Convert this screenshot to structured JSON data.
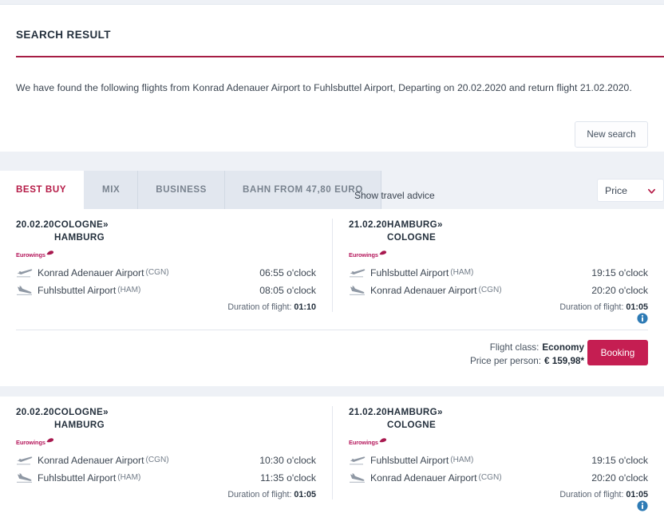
{
  "header": {
    "title": "SEARCH RESULT",
    "intro": "We have found the following flights from Konrad Adenauer Airport to Fuhlsbuttel Airport, Departing on 20.02.2020 and return flight 21.02.2020.",
    "new_search_label": "New search"
  },
  "tabs": [
    {
      "label": "BEST BUY",
      "active": true
    },
    {
      "label": "MIX",
      "active": false
    },
    {
      "label": "BUSINESS",
      "active": false
    },
    {
      "label": "BAHN FROM 47,80 EURO",
      "active": false
    }
  ],
  "toolbar": {
    "travel_advice_label": "Show travel advice",
    "sort_value": "Price"
  },
  "labels": {
    "duration_label": "Duration of flight:",
    "flight_class_label": "Flight class:",
    "price_label": "Price per person:",
    "booking_label": "Booking",
    "clock_suffix": "o'clock",
    "route_arrow": "»",
    "airline_name": "Eurowings"
  },
  "colors": {
    "accent": "#a61d44",
    "brand": "#c51e52",
    "airline": "#b5185c",
    "info": "#2e7bb5",
    "page_bg": "#eef1f6",
    "tab_inactive_bg": "#e2e7ef"
  },
  "results": [
    {
      "outbound": {
        "date": "20.02.20",
        "from_city": "COLOGNE",
        "to_city": "HAMBURG",
        "airline": "Eurowings",
        "depart_airport": "Konrad Adenauer Airport",
        "depart_code": "(CGN)",
        "depart_time": "06:55 o'clock",
        "arrive_airport": "Fuhlsbuttel Airport",
        "arrive_code": "(HAM)",
        "arrive_time": "08:05 o'clock",
        "duration": "01:10"
      },
      "inbound": {
        "date": "21.02.20",
        "from_city": "HAMBURG",
        "to_city": "COLOGNE",
        "airline": "Eurowings",
        "depart_airport": "Fuhlsbuttel Airport",
        "depart_code": "(HAM)",
        "depart_time": "19:15 o'clock",
        "arrive_airport": "Konrad Adenauer Airport",
        "arrive_code": "(CGN)",
        "arrive_time": "20:20 o'clock",
        "duration": "01:05"
      },
      "flight_class": "Economy",
      "price": "€ 159,98*"
    },
    {
      "outbound": {
        "date": "20.02.20",
        "from_city": "COLOGNE",
        "to_city": "HAMBURG",
        "airline": "Eurowings",
        "depart_airport": "Konrad Adenauer Airport",
        "depart_code": "(CGN)",
        "depart_time": "10:30 o'clock",
        "arrive_airport": "Fuhlsbuttel Airport",
        "arrive_code": "(HAM)",
        "arrive_time": "11:35 o'clock",
        "duration": "01:05"
      },
      "inbound": {
        "date": "21.02.20",
        "from_city": "HAMBURG",
        "to_city": "COLOGNE",
        "airline": "Eurowings",
        "depart_airport": "Fuhlsbuttel Airport",
        "depart_code": "(HAM)",
        "depart_time": "19:15 o'clock",
        "arrive_airport": "Konrad Adenauer Airport",
        "arrive_code": "(CGN)",
        "arrive_time": "20:20 o'clock",
        "duration": "01:05"
      }
    }
  ]
}
